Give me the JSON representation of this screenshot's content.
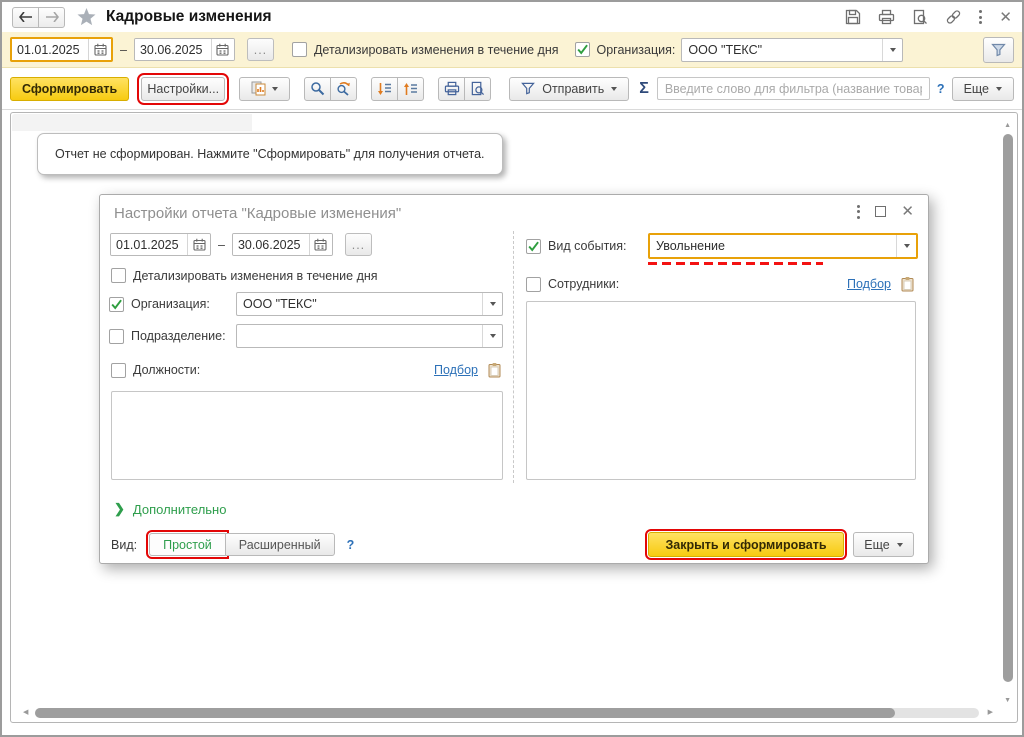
{
  "titlebar": {
    "title": "Кадровые изменения"
  },
  "filterbar": {
    "date_from": "01.01.2025",
    "range_dash": "–",
    "date_to": "30.06.2025",
    "more_button": "...",
    "detail_label": "Детализировать изменения в течение дня",
    "org_label": "Организация:",
    "org_value": "ООО \"ТЕКС\""
  },
  "toolbar": {
    "generate": "Сформировать",
    "settings": "Настройки...",
    "send": "Отправить",
    "sigma": "Σ",
    "filter_placeholder": "Введите слово для фильтра (название товара, поку...",
    "help": "?",
    "more": "Еще"
  },
  "content": {
    "empty_message": "Отчет не сформирован. Нажмите \"Сформировать\" для получения отчета."
  },
  "dialog": {
    "title": "Настройки отчета \"Кадровые изменения\"",
    "date_from": "01.01.2025",
    "range_dash": "–",
    "date_to": "30.06.2025",
    "more_button": "...",
    "detail_label": "Детализировать изменения в течение дня",
    "org_label": "Организация:",
    "org_value": "ООО \"ТЕКС\"",
    "department_label": "Подразделение:",
    "positions_label": "Должности:",
    "positions_pick": "Подбор",
    "event_label": "Вид события:",
    "event_value": "Увольнение",
    "employees_label": "Сотрудники:",
    "employees_pick": "Подбор",
    "additional": "Дополнительно",
    "view_label": "Вид:",
    "view_simple": "Простой",
    "view_extended": "Расширенный",
    "help": "?",
    "close_generate": "Закрыть и сформировать",
    "more": "Еще"
  },
  "colors": {
    "accent_yellow": "#F7CB11",
    "annotation_red": "#E30707",
    "focus_orange": "#E8A109",
    "check_green": "#2E9E3F",
    "link_blue": "#2D71B8",
    "section_green": "#2E9E4C",
    "filterbar_bg": "#FBF3D4"
  }
}
